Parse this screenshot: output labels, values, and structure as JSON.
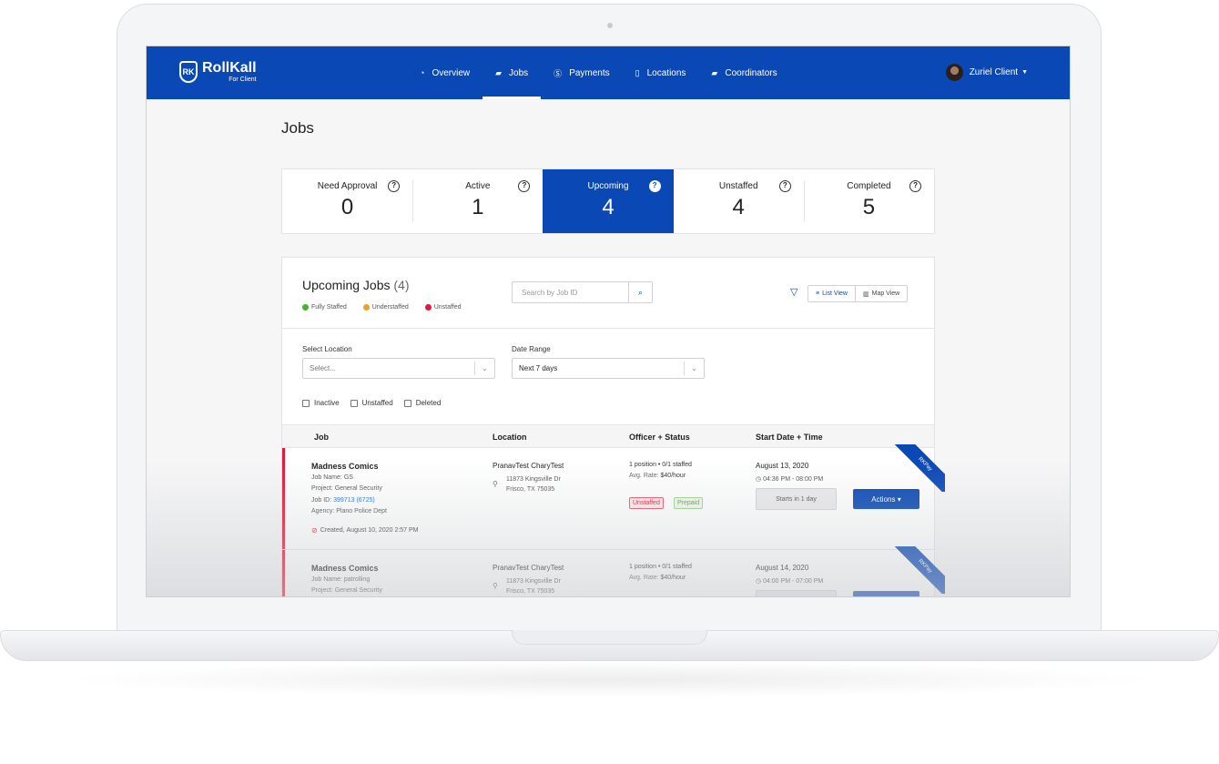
{
  "brand": {
    "name": "RollKall",
    "sub": "For Client",
    "mark": "RK"
  },
  "nav": {
    "items": [
      {
        "label": "Overview",
        "icon": "dashboard-icon"
      },
      {
        "label": "Jobs",
        "icon": "briefcase-icon"
      },
      {
        "label": "Payments",
        "icon": "dollar-icon"
      },
      {
        "label": "Locations",
        "icon": "building-icon"
      },
      {
        "label": "Coordinators",
        "icon": "briefcase-icon"
      }
    ],
    "active": "Jobs"
  },
  "user": {
    "name": "Zuriel Client"
  },
  "page": {
    "title": "Jobs"
  },
  "stats": [
    {
      "label": "Need Approval",
      "value": "0"
    },
    {
      "label": "Active",
      "value": "1"
    },
    {
      "label": "Upcoming",
      "value": "4"
    },
    {
      "label": "Unstaffed",
      "value": "4"
    },
    {
      "label": "Completed",
      "value": "5"
    }
  ],
  "panel": {
    "title": "Upcoming Jobs",
    "count": "(4)",
    "legend": [
      {
        "label": "Fully Staffed",
        "color": "#4caf2f"
      },
      {
        "label": "Understaffed",
        "color": "#f0a022"
      },
      {
        "label": "Unstaffed",
        "color": "#e3193b"
      }
    ],
    "search_placeholder": "Search by Job ID",
    "views": {
      "list": "List View",
      "map": "Map View"
    },
    "filters": {
      "location_label": "Select Location",
      "location_value": "Select...",
      "date_label": "Date Range",
      "date_value": "Next 7 days"
    },
    "checkboxes": [
      "Inactive",
      "Unstaffed",
      "Deleted"
    ],
    "columns": [
      "Job",
      "Location",
      "Officer + Status",
      "Start Date + Time"
    ]
  },
  "rows": [
    {
      "title": "Madness Comics",
      "job_name": "Job Name:",
      "job_name_value": "GS",
      "project": "Project:",
      "project_value": "General Security",
      "job_id": "Job ID:",
      "job_id_value": "399713",
      "job_id_sub": "(6725)",
      "agency": "Agency:",
      "agency_value": "Plano Police Dept",
      "created": "Created,",
      "created_value": "August 10, 2020 2:57 PM",
      "location": "PranavTest CharyTest",
      "address1": "11873 Kingsville Dr",
      "address2": "Frisco, TX 75035",
      "positions": "1 position • 0/1 staffed",
      "rate_label": "Avg. Rate:",
      "rate_value": "$40/hour",
      "badge1": "Unstaffed",
      "badge2": "Prepaid",
      "date": "August 13, 2020",
      "time": "04:36 PM - 08:00 PM",
      "starts": "Starts in 1 day",
      "actions": "Actions",
      "ribbon": "RKPay"
    },
    {
      "title": "Madness Comics",
      "job_name": "Job Name:",
      "job_name_value": "patrolling",
      "project": "Project:",
      "project_value": "General Security",
      "location": "PranavTest CharyTest",
      "address1": "11873 Kingsville Dr",
      "address2": "Frisco, TX 75035",
      "positions": "1 position • 0/1 staffed",
      "rate_label": "Avg. Rate:",
      "rate_value": "$40/hour",
      "date": "August 14, 2020",
      "time": "04:00 PM - 07:00 PM",
      "ribbon": "RKPay"
    }
  ]
}
